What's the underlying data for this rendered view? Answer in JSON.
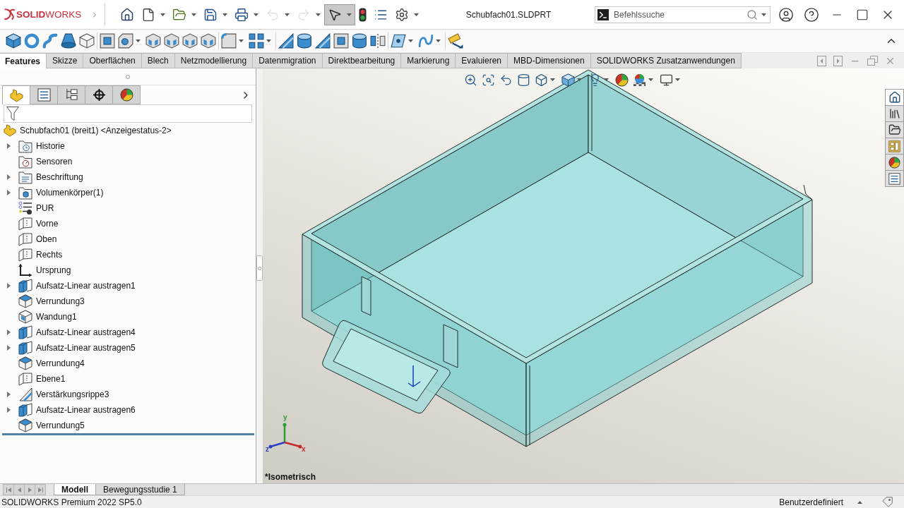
{
  "title_bar": {
    "logo": "**SOLID**WORKS",
    "quick_access": [
      {
        "kind": "home",
        "dropdown": false,
        "disabled": false,
        "selected": false
      },
      {
        "kind": "new",
        "dropdown": true,
        "disabled": false,
        "selected": false
      },
      {
        "kind": "open",
        "dropdown": true,
        "disabled": false,
        "selected": false
      },
      {
        "kind": "save",
        "dropdown": true,
        "disabled": false,
        "selected": false
      },
      {
        "kind": "print",
        "dropdown": true,
        "disabled": false,
        "selected": false
      },
      {
        "kind": "undo",
        "dropdown": true,
        "disabled": true,
        "selected": false
      },
      {
        "kind": "redo",
        "dropdown": true,
        "disabled": true,
        "selected": false
      },
      {
        "kind": "select",
        "dropdown": true,
        "disabled": false,
        "selected": true
      },
      {
        "kind": "rebuild",
        "dropdown": false,
        "disabled": false,
        "selected": false
      },
      {
        "kind": "file-properties",
        "dropdown": false,
        "disabled": false,
        "selected": false
      },
      {
        "kind": "options",
        "dropdown": true,
        "disabled": false,
        "selected": false
      }
    ],
    "document_title": "Schubfach01.SLDPRT",
    "search": {
      "placeholder": "Befehlssuche"
    }
  },
  "command_manager": {
    "groups": [
      {
        "tools": [
          {
            "kind": "extruded-boss",
            "dropdown": false
          },
          {
            "kind": "revolved-boss",
            "dropdown": false
          },
          {
            "kind": "swept-boss",
            "dropdown": false
          },
          {
            "kind": "lofted-boss",
            "dropdown": false
          },
          {
            "kind": "boundary-boss",
            "dropdown": false
          }
        ]
      },
      {
        "tools": [
          {
            "kind": "extruded-cut",
            "dropdown": false
          },
          {
            "kind": "hole-wizard",
            "dropdown": true
          },
          {
            "kind": "revolved-cut",
            "dropdown": false
          },
          {
            "kind": "swept-cut",
            "dropdown": false
          },
          {
            "kind": "lofted-cut",
            "dropdown": false
          },
          {
            "kind": "boundary-cut",
            "dropdown": false
          }
        ]
      },
      {
        "tools": [
          {
            "kind": "fillet",
            "dropdown": true
          },
          {
            "kind": "linear-pattern",
            "dropdown": true
          }
        ]
      },
      {
        "tools": [
          {
            "kind": "rib",
            "dropdown": false
          },
          {
            "kind": "wrap",
            "dropdown": false
          },
          {
            "kind": "draft",
            "dropdown": false
          },
          {
            "kind": "shell",
            "dropdown": false
          },
          {
            "kind": "intersect",
            "dropdown": false
          },
          {
            "kind": "mirror",
            "dropdown": false
          }
        ]
      },
      {
        "tools": [
          {
            "kind": "reference-geometry",
            "dropdown": true
          },
          {
            "kind": "curves",
            "dropdown": true
          }
        ]
      },
      {
        "tools": [
          {
            "kind": "instant3d",
            "dropdown": false
          }
        ]
      }
    ]
  },
  "tabs": [
    {
      "label": "Features",
      "selected": true
    },
    {
      "label": "Skizze",
      "selected": false
    },
    {
      "label": "Oberflächen",
      "selected": false
    },
    {
      "label": "Blech",
      "selected": false
    },
    {
      "label": "Netzmodellierung",
      "selected": false
    },
    {
      "label": "Datenmigration",
      "selected": false
    },
    {
      "label": "Direktbearbeitung",
      "selected": false
    },
    {
      "label": "Markierung",
      "selected": false
    },
    {
      "label": "Evaluieren",
      "selected": false
    },
    {
      "label": "MBD-Dimensionen",
      "selected": false
    },
    {
      "label": "SOLIDWORKS Zusatzanwendungen",
      "selected": false
    }
  ],
  "feature_manager": {
    "panel_tabs": [
      {
        "kind": "features",
        "selected": true
      },
      {
        "kind": "properties",
        "selected": false
      },
      {
        "kind": "configurations",
        "selected": false
      },
      {
        "kind": "dimxpert",
        "selected": false
      },
      {
        "kind": "display",
        "selected": false
      }
    ],
    "root": {
      "label": "Schubfach01 (breit1) <Anzeigestatus-2>"
    },
    "items": [
      {
        "label": "Historie",
        "kind": "history",
        "expandable": true
      },
      {
        "label": "Sensoren",
        "kind": "sensors",
        "expandable": false
      },
      {
        "label": "Beschriftung",
        "kind": "annotations",
        "expandable": true
      },
      {
        "label": "Volumenkörper(1)",
        "kind": "solid-bodies",
        "expandable": true
      },
      {
        "label": "PUR",
        "kind": "material",
        "expandable": false
      },
      {
        "label": "Vorne",
        "kind": "plane",
        "expandable": false
      },
      {
        "label": "Oben",
        "kind": "plane",
        "expandable": false
      },
      {
        "label": "Rechts",
        "kind": "plane",
        "expandable": false
      },
      {
        "label": "Ursprung",
        "kind": "origin",
        "expandable": false
      },
      {
        "label": "Aufsatz-Linear austragen1",
        "kind": "boss-extrude",
        "expandable": true
      },
      {
        "label": "Verrundung3",
        "kind": "fillet",
        "expandable": false
      },
      {
        "label": "Wandung1",
        "kind": "shell",
        "expandable": false
      },
      {
        "label": "Aufsatz-Linear austragen4",
        "kind": "boss-extrude",
        "expandable": true
      },
      {
        "label": "Aufsatz-Linear austragen5",
        "kind": "boss-extrude",
        "expandable": true
      },
      {
        "label": "Verrundung4",
        "kind": "fillet",
        "expandable": false
      },
      {
        "label": "Ebene1",
        "kind": "plane",
        "expandable": false
      },
      {
        "label": "Verstärkungsrippe3",
        "kind": "rib",
        "expandable": true
      },
      {
        "label": "Aufsatz-Linear austragen6",
        "kind": "boss-extrude",
        "expandable": true
      },
      {
        "label": "Verrundung5",
        "kind": "fillet",
        "expandable": false
      }
    ]
  },
  "viewport": {
    "view_tools": [
      {
        "kind": "zoom-to-fit",
        "dropdown": false
      },
      {
        "kind": "zoom-to-area",
        "dropdown": false
      },
      {
        "kind": "previous-view",
        "dropdown": false
      },
      {
        "kind": "section-view",
        "dropdown": false
      },
      {
        "kind": "view-orientation",
        "dropdown": true
      },
      {
        "kind": "display-style",
        "dropdown": true
      },
      {
        "kind": "hide-show",
        "dropdown": true
      },
      {
        "kind": "edit-appearance",
        "dropdown": false
      },
      {
        "kind": "apply-scene",
        "dropdown": true
      },
      {
        "kind": "view-settings",
        "dropdown": true
      }
    ],
    "task_pane": [
      {
        "kind": "home",
        "selected": true
      },
      {
        "kind": "design-library",
        "selected": false
      },
      {
        "kind": "file-explorer",
        "selected": false
      },
      {
        "kind": "view-palette",
        "selected": false
      },
      {
        "kind": "appearances",
        "selected": false
      },
      {
        "kind": "custom-properties",
        "selected": false
      }
    ],
    "triad": [
      {
        "label": "y",
        "color": "#2e9e2e"
      },
      {
        "label": "z",
        "color": "#2a3fc4"
      },
      {
        "label": "x",
        "color": "#c42a2a"
      }
    ],
    "view_name": "*Isometrisch"
  },
  "bottom_tabs": [
    {
      "label": "Modell",
      "selected": true
    },
    {
      "label": "Bewegungsstudie 1",
      "selected": false
    }
  ],
  "status_bar": {
    "product": "SOLIDWORKS Premium 2022 SP5.0",
    "units": "Benutzerdefiniert"
  }
}
